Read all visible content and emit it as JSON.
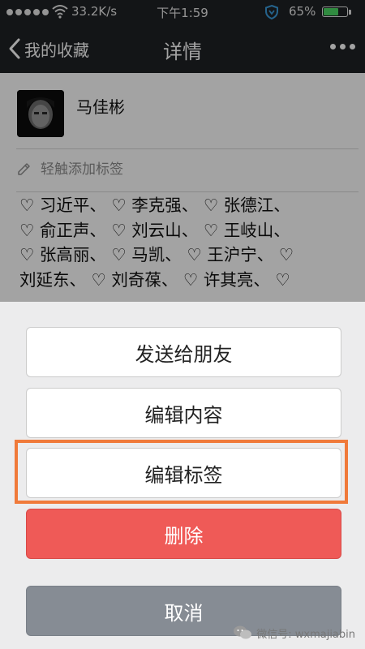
{
  "status_bar": {
    "net_speed": "33.2K/s",
    "time": "下午1:59",
    "battery_percent": "65%",
    "battery_level": 0.65,
    "battery_color": "#4cd964"
  },
  "nav": {
    "back_label": "我的收藏",
    "title": "详情",
    "back_icon": "chevron-left-icon",
    "more_icon": "more-icon"
  },
  "detail": {
    "author": "马佳彬",
    "add_tag_label": "轻触添加标签",
    "name_lines": [
      "♡ 习近平、 ♡ 李克强、 ♡ 张德江、",
      "♡ 俞正声、 ♡ 刘云山、 ♡ 王岐山、",
      "♡ 张高丽、 ♡ 马凯、 ♡ 王沪宁、 ♡",
      "刘延东、 ♡ 刘奇葆、 ♡ 许其亮、 ♡"
    ]
  },
  "action_sheet": {
    "send": "发送给朋友",
    "edit_content": "编辑内容",
    "edit_tags": "编辑标签",
    "delete": "删除",
    "cancel": "取消"
  },
  "colors": {
    "bar_bg": "#1f2124",
    "delete_red": "#ef5a57",
    "cancel_gray": "#868c94",
    "highlight_orange": "#f07a3a"
  },
  "watermark": {
    "text": "微信号: wxmajiabin"
  }
}
